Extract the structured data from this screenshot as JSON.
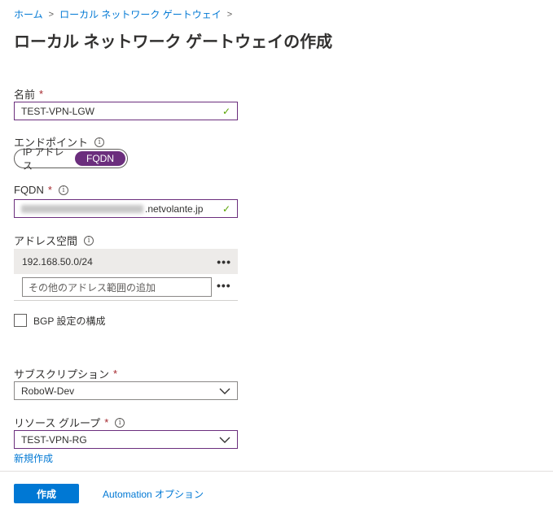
{
  "breadcrumb": {
    "home": "ホーム",
    "current": "ローカル ネットワーク ゲートウェイ",
    "separator": ">"
  },
  "page_title": "ローカル ネットワーク ゲートウェイの作成",
  "form": {
    "name": {
      "label": "名前",
      "required_mark": "*",
      "value": "TEST-VPN-LGW"
    },
    "endpoint": {
      "label": "エンドポイント",
      "options": [
        "IP アドレス",
        "FQDN"
      ],
      "selected": "FQDN"
    },
    "fqdn": {
      "label": "FQDN",
      "required_mark": "*",
      "value_suffix": ".netvolante.jp"
    },
    "address_space": {
      "label": "アドレス空間",
      "entries": [
        "192.168.50.0/24"
      ],
      "add_placeholder": "その他のアドレス範囲の追加",
      "more_symbol": "•••"
    },
    "bgp": {
      "label": "BGP 設定の構成",
      "checked": false
    },
    "subscription": {
      "label": "サブスクリプション",
      "required_mark": "*",
      "value": "RoboW-Dev"
    },
    "resource_group": {
      "label": "リソース グループ",
      "required_mark": "*",
      "value": "TEST-VPN-RG",
      "new_link": "新規作成"
    }
  },
  "footer": {
    "create_button": "作成",
    "automation_link": "Automation オプション"
  },
  "colors": {
    "accent": "#0078d4",
    "toggle_selected": "#6b2e7d",
    "valid": "#57a300",
    "required": "#a4262c"
  }
}
